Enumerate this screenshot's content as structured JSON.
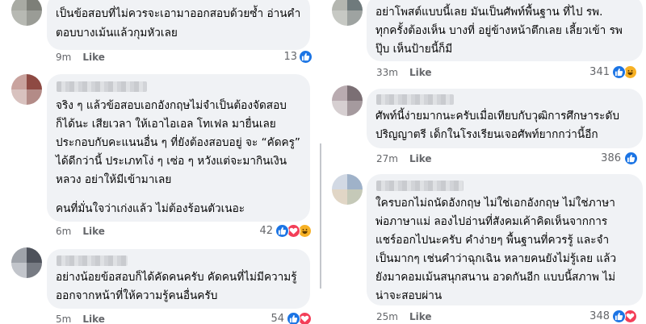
{
  "like_label": "Like",
  "colors": {
    "like_blue": "#1b74e4",
    "love_red": "#f33e58",
    "haha_yellow": "#f7b125",
    "bubble": "#f0f2f5",
    "meta_gray": "#65676b"
  },
  "left_comments": [
    {
      "lines": [
        "เป็นข้อสอบที่ไม่ควรจะเอามาออกสอบด้วยซ้ำ อ่านคำ",
        "ตอบบางเม้นแล้วกุมหัวเลย"
      ],
      "time": "9m",
      "reaction_count": "13",
      "reactions": [
        "like-icon"
      ]
    },
    {
      "lines": [
        "จริง ๆ แล้วข้อสอบเอกอังกฤษไม่จำเป็นต้องจัดสอบ",
        "ก็ได้นะ เสียเวลา ให้เอาไอเอล โทเฟล มายื่นเลย",
        "ประกอบกับคะแนนอื่น ๆ ที่ยังต้องสอบอยู่ จะ “คัดครู”",
        "ได้ดีกว่านี้ ประเภทโง่ ๆ เซ่อ ๆ หวังแต่จะมากินเงิน",
        "หลวง อย่าให้มีเข้ามาเลย",
        "",
        "คนที่มั่นใจว่าเก่งแล้ว ไม่ต้องร้อนตัวเนอะ"
      ],
      "time": "6m",
      "reaction_count": "42",
      "reactions": [
        "like-icon",
        "love-icon",
        "haha-icon"
      ]
    },
    {
      "lines": [
        "อย่างน้อยข้อสอบก็ได้คัดคนครับ คัดคนที่ไม่มีความรู้",
        "ออกจากหน้าที่ให้ความรู้คนอื่นครับ"
      ],
      "time": "5m",
      "reaction_count": "54",
      "reactions": [
        "like-icon",
        "love-icon"
      ]
    }
  ],
  "right_comments": [
    {
      "lines": [
        "อย่าโพสต์แบบนี้เลย มันเป็นศัพท์พื้นฐาน ที่ไป รพ.",
        "ทุกครั้งต้องเห็น บางที่ อยู่ข้างหน้าตึกเลย เลี้ยวเข้า รพ",
        "ปุ๊บ เห็นป้ายนี้ก็มี"
      ],
      "time": "33m",
      "reaction_count": "341",
      "reactions": [
        "like-icon",
        "haha-icon"
      ]
    },
    {
      "lines": [
        "ศัพท์นี้ง่ายมากนะครับเมื่อเทียบกับวุฒิการศึกษาระดับ",
        "ปริญญาตรี เด็กในโรงเรียนเจอศัพท์ยากกว่านี้อีก"
      ],
      "time": "27m",
      "reaction_count": "386",
      "reactions": [
        "like-icon"
      ]
    },
    {
      "lines": [
        "ใครบอกไม่ถนัดอังกฤษ ไม่ใช่เอกอังกฤษ ไม่ใช่ภาษา",
        "พ่อภาษาแม่ ลองไปอ่านที่สังคมเค้าคิดเห็นจากการ",
        "แชร์ออกไปนะครับ คำง่ายๆ พื้นฐานที่ควรรู้ และจำ",
        "เป็นมากๆ เช่นคำว่าฉุกเฉิน หลายคนยังไม่รู้เลย แล้ว",
        "ยังมาคอมเม้นสนุกสนาน อวดกันอีก แบบนี้สภาพ ไม่",
        "น่าจะสอบผ่าน"
      ],
      "time": "25m",
      "reaction_count": "348",
      "reactions": [
        "like-icon",
        "love-icon"
      ]
    }
  ]
}
